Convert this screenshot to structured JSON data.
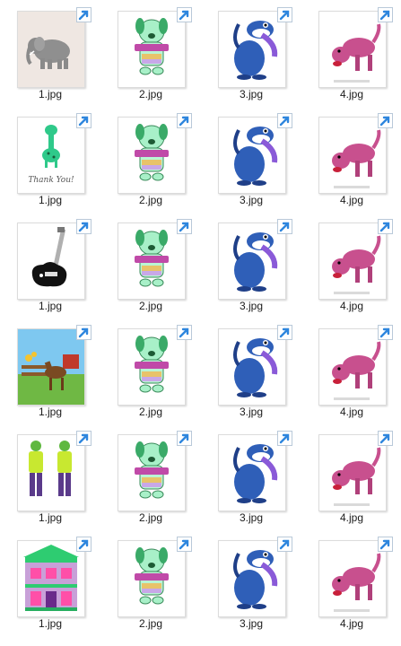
{
  "view": "large icons",
  "files": [
    {
      "name": "1.jpg",
      "thumb": "elephant"
    },
    {
      "name": "2.jpg",
      "thumb": "green-puppy-harmonica"
    },
    {
      "name": "3.jpg",
      "thumb": "blue-dog"
    },
    {
      "name": "4.jpg",
      "thumb": "pink-dog"
    },
    {
      "name": "1.jpg",
      "thumb": "giraffe-thank-you"
    },
    {
      "name": "2.jpg",
      "thumb": "green-puppy-harmonica"
    },
    {
      "name": "3.jpg",
      "thumb": "blue-dog"
    },
    {
      "name": "4.jpg",
      "thumb": "pink-dog"
    },
    {
      "name": "1.jpg",
      "thumb": "electric-guitar"
    },
    {
      "name": "2.jpg",
      "thumb": "green-puppy-harmonica"
    },
    {
      "name": "3.jpg",
      "thumb": "blue-dog"
    },
    {
      "name": "4.jpg",
      "thumb": "pink-dog"
    },
    {
      "name": "1.jpg",
      "thumb": "horse-farm"
    },
    {
      "name": "2.jpg",
      "thumb": "green-puppy-harmonica"
    },
    {
      "name": "3.jpg",
      "thumb": "blue-dog"
    },
    {
      "name": "4.jpg",
      "thumb": "pink-dog"
    },
    {
      "name": "1.jpg",
      "thumb": "green-men"
    },
    {
      "name": "2.jpg",
      "thumb": "green-puppy-harmonica"
    },
    {
      "name": "3.jpg",
      "thumb": "blue-dog"
    },
    {
      "name": "4.jpg",
      "thumb": "pink-dog"
    },
    {
      "name": "1.jpg",
      "thumb": "dollhouse"
    },
    {
      "name": "2.jpg",
      "thumb": "green-puppy-harmonica"
    },
    {
      "name": "3.jpg",
      "thumb": "blue-dog"
    },
    {
      "name": "4.jpg",
      "thumb": "pink-dog"
    }
  ],
  "thank_you_text": "Thank You!",
  "shortcut_icon": "shortcut-arrow-icon",
  "colors": {
    "puppy": "#a8f0c8",
    "blue_dog": "#2f5fb8",
    "pink_dog": "#c8508e",
    "shortcut_arrow": "#2e86de"
  }
}
